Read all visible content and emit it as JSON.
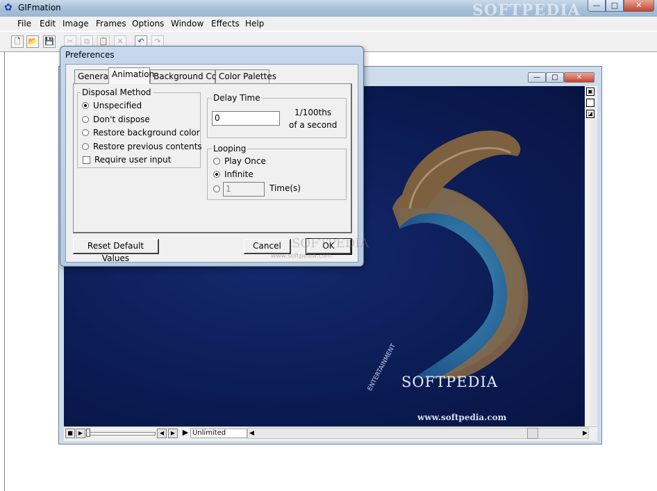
{
  "app": {
    "title": "GIFmation",
    "watermark": "SOFTPEDIA"
  },
  "window_buttons": {
    "minimize": "—",
    "maximize": "□",
    "close": "✕"
  },
  "menu": [
    "File",
    "Edit",
    "Image",
    "Frames",
    "Options",
    "Window",
    "Effects",
    "Help"
  ],
  "toolbar": [
    {
      "name": "new-icon",
      "glyph": "🗋"
    },
    {
      "name": "open-icon",
      "glyph": "📂"
    },
    {
      "name": "save-icon",
      "glyph": "💾"
    },
    {
      "name": "cut-icon",
      "glyph": "✂"
    },
    {
      "name": "copy-icon",
      "glyph": "⧉"
    },
    {
      "name": "paste-icon",
      "glyph": "📋"
    },
    {
      "name": "delete-icon",
      "glyph": "✕"
    },
    {
      "name": "undo-icon",
      "glyph": "↶"
    },
    {
      "name": "redo-icon",
      "glyph": "↷"
    }
  ],
  "image": {
    "logo_text": "SOFTPEDIA",
    "url_text": "www.softpedia.com",
    "side_text": "ENTERTAINMENT"
  },
  "player": {
    "loop_value": "Unlimited"
  },
  "dialog": {
    "title": "Preferences",
    "tabs": [
      "General",
      "Animation",
      "Background Color",
      "Color Palettes"
    ],
    "active_tab": "Animation",
    "disposal": {
      "label": "Disposal Method",
      "options": [
        "Unspecified",
        "Don't dispose",
        "Restore background color",
        "Restore previous contents"
      ],
      "selected": "Unspecified",
      "checkbox_label": "Require user input",
      "checkbox_checked": false
    },
    "delay": {
      "label": "Delay Time",
      "value": "0",
      "unit_line1": "1/100ths",
      "unit_line2": "of a second"
    },
    "looping": {
      "label": "Looping",
      "options": [
        "Play Once",
        "Infinite"
      ],
      "selected": "Infinite",
      "times_value": "1",
      "times_label": "Time(s)"
    },
    "buttons": {
      "reset": "Reset Default Values",
      "cancel": "Cancel",
      "ok": "OK"
    },
    "watermark": "SOFTPEDIA",
    "watermark_url": "www.softpedia.com"
  }
}
